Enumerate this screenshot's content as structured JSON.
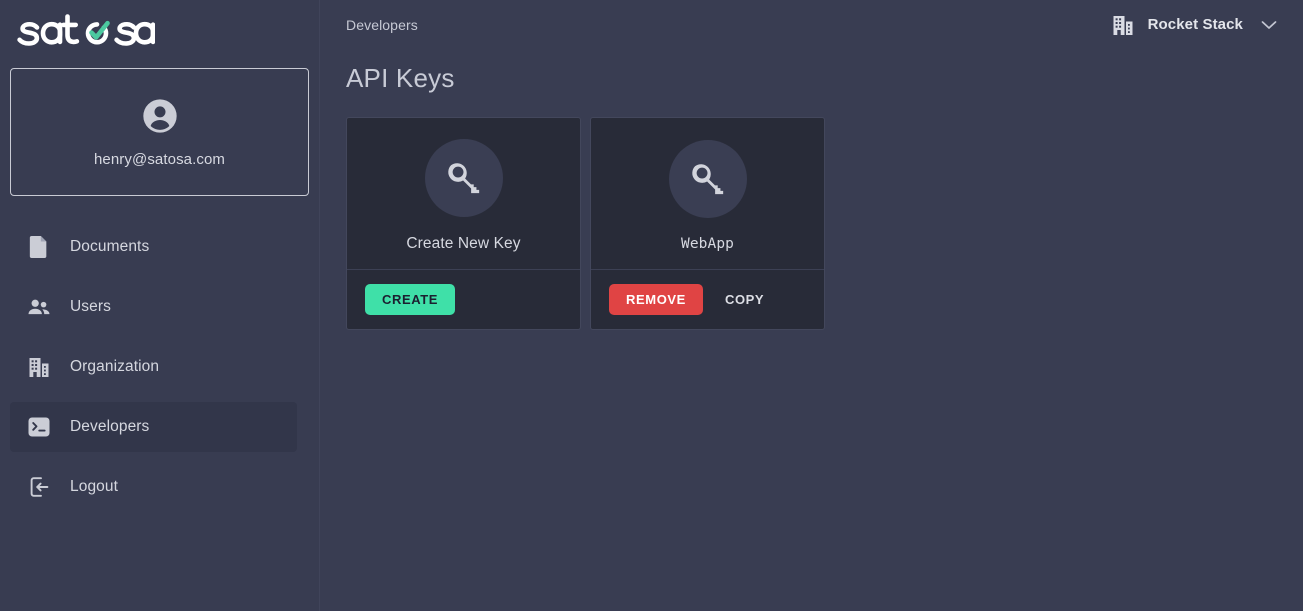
{
  "brand": {
    "name": "satosa",
    "accent_color": "#4CC9A0",
    "logo_text_color": "#FFFFFF"
  },
  "sidebar": {
    "profile": {
      "avatar_icon": "user-avatar-icon",
      "email": "henry@satosa.com"
    },
    "items": [
      {
        "label": "Documents",
        "icon": "document-icon",
        "active": false
      },
      {
        "label": "Users",
        "icon": "users-icon",
        "active": false
      },
      {
        "label": "Organization",
        "icon": "building-icon",
        "active": false
      },
      {
        "label": "Developers",
        "icon": "terminal-icon",
        "active": true
      },
      {
        "label": "Logout",
        "icon": "logout-icon",
        "active": false
      }
    ]
  },
  "topbar": {
    "breadcrumb": "Developers",
    "org": {
      "icon": "building-icon",
      "name": "Rocket Stack",
      "chevron": "chevron-down-icon"
    }
  },
  "main": {
    "title": "API Keys",
    "cards": [
      {
        "icon": "key-icon",
        "label": "Create New Key",
        "label_mono": false,
        "actions": [
          {
            "label": "CREATE",
            "style": "create",
            "color": "#3FE0A8"
          }
        ]
      },
      {
        "icon": "key-icon",
        "label": "WebApp",
        "label_mono": true,
        "actions": [
          {
            "label": "REMOVE",
            "style": "remove",
            "color": "#E04444"
          },
          {
            "label": "COPY",
            "style": "text",
            "color": "#DCDEE5"
          }
        ]
      }
    ]
  },
  "colors": {
    "sidebar_bg": "#383C51",
    "main_bg": "#393D52",
    "card_bg": "#282B38",
    "active_nav_bg": "#32364A",
    "key_circle_bg": "#3A3E53",
    "text_primary": "#D5D7DF",
    "accent_green": "#3FE0A8",
    "danger_red": "#E04444"
  }
}
